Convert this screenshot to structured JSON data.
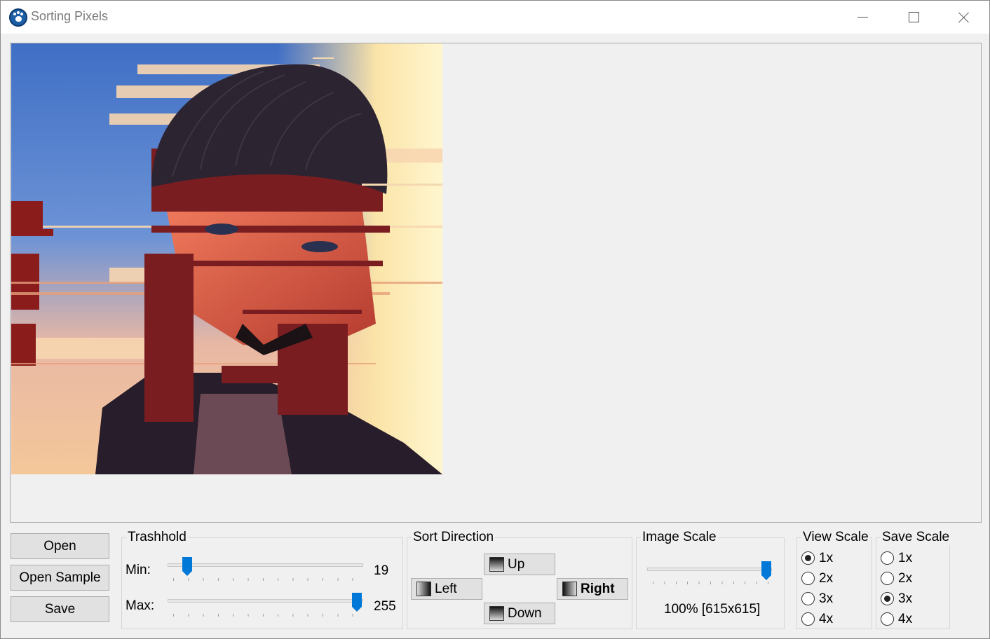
{
  "window": {
    "title": "Sorting Pixels"
  },
  "actions": {
    "open": "Open",
    "open_sample": "Open Sample",
    "save": "Save"
  },
  "threshold": {
    "title": "Trashhold",
    "min_label": "Min:",
    "min_value": "19",
    "max_label": "Max:",
    "max_value": "255",
    "range_max": 255
  },
  "sort_direction": {
    "title": "Sort Direction",
    "up": "Up",
    "left": "Left",
    "right": "Right",
    "down": "Down",
    "selected": "Right"
  },
  "image_scale": {
    "title": "Image Scale",
    "value_percent": 100,
    "readout": "100% [615x615]"
  },
  "view_scale": {
    "title": "View Scale",
    "options": [
      "1x",
      "2x",
      "3x",
      "4x"
    ],
    "selected": "1x"
  },
  "save_scale": {
    "title": "Save Scale",
    "options": [
      "1x",
      "2x",
      "3x",
      "4x"
    ],
    "selected": "3x"
  },
  "colors": {
    "accent": "#0078d7",
    "sky_blue": "#4a78c4",
    "sunset_orange": "#f08a4b",
    "hat_dark": "#2b2230"
  },
  "icons": {
    "app": "paw-icon"
  }
}
